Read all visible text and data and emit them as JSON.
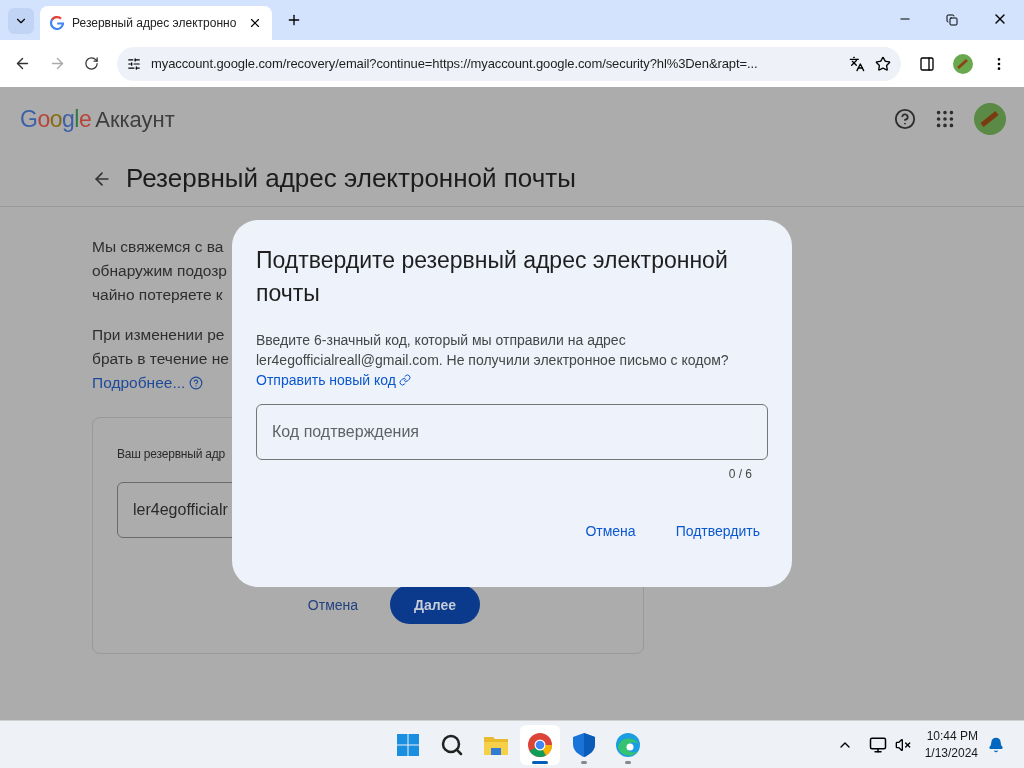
{
  "browser": {
    "tab_title": "Резервный адрес электронно",
    "url": "myaccount.google.com/recovery/email?continue=https://myaccount.google.com/security?hl%3Den&rapt=..."
  },
  "header": {
    "logo": "Google",
    "product": "Аккаунт"
  },
  "page": {
    "title": "Резервный адрес электронной почты",
    "paragraphs": [
      [
        "Мы свяжемся с ва",
        "обнаружим подозр",
        "чайно потеряете к"
      ],
      [
        "При изменении ре",
        "брать в течение не"
      ]
    ],
    "link": "Подробнее...",
    "card": {
      "label": "Ваш резервный адр",
      "value": "ler4egofficialr"
    },
    "buttons": [
      {
        "label": "Отмена",
        "kind": "text"
      },
      {
        "label": "Далее",
        "kind": "filled"
      }
    ]
  },
  "dialog": {
    "title": "Подтвердите резервный адрес электронной почты",
    "body": "Введите 6-значный код, который мы отправили на адрес ler4egofficialreall@gmail.com. Не получили электронное письмо с кодом?",
    "link": "Отправить новый код",
    "field": {
      "placeholder": "Код подтверждения",
      "counter": "0 / 6"
    },
    "buttons": [
      {
        "label": "Отмена"
      },
      {
        "label": "Подтвердить"
      }
    ]
  },
  "taskbar": {
    "apps": [
      {
        "kind": "start",
        "selected": false,
        "running": false
      },
      {
        "kind": "search",
        "selected": false,
        "running": false
      },
      {
        "kind": "files",
        "selected": false,
        "running": false
      },
      {
        "kind": "chrome",
        "selected": true,
        "running": true
      },
      {
        "kind": "security",
        "selected": false,
        "running": true
      },
      {
        "kind": "edge",
        "selected": false,
        "running": true
      }
    ],
    "time": "10:44 PM",
    "date": "1/13/2024"
  }
}
